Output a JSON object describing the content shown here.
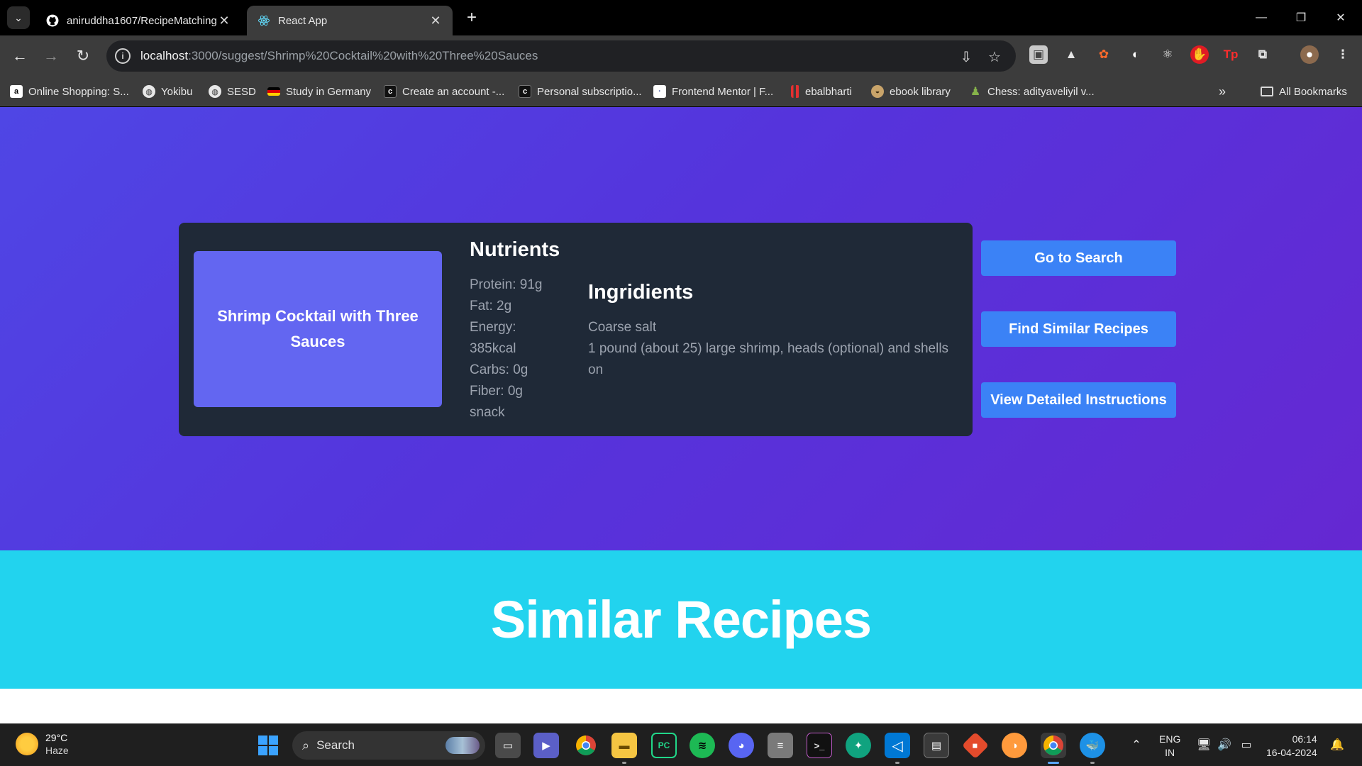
{
  "browser": {
    "tabs": [
      {
        "title": "aniruddha1607/RecipeMatching",
        "icon": "github-icon",
        "active": false
      },
      {
        "title": "React App",
        "icon": "react-icon",
        "active": true
      }
    ],
    "url_host": "localhost",
    "url_path": ":3000/suggest/Shrimp%20Cocktail%20with%20Three%20Sauces",
    "bookmarks": [
      {
        "label": "Online Shopping: S...",
        "icon": "amazon-icon"
      },
      {
        "label": "Yokibu",
        "icon": "globe-icon"
      },
      {
        "label": "SESD",
        "icon": "globe-icon"
      },
      {
        "label": "Study in Germany",
        "icon": "flag-icon"
      },
      {
        "label": "Create an account -...",
        "icon": "codechef-icon"
      },
      {
        "label": "Personal subscriptio...",
        "icon": "codechef-icon"
      },
      {
        "label": "Frontend Mentor | F...",
        "icon": "frontend-mentor-icon"
      },
      {
        "label": "ebalbharti",
        "icon": "book-icon"
      },
      {
        "label": "ebook library",
        "icon": "library-icon"
      },
      {
        "label": "Chess: adityaveliyil v...",
        "icon": "chess-icon"
      }
    ],
    "all_bookmarks_label": "All Bookmarks"
  },
  "recipe": {
    "name": "Shrimp Cocktail with Three Sauces",
    "nutrients_heading": "Nutrients",
    "nutrients": [
      "Protein: 91g",
      "Fat: 2g",
      "Energy: 385kcal",
      "Carbs: 0g",
      "Fiber: 0g",
      "snack"
    ],
    "ingredients_heading": "Ingridients",
    "ingredients": [
      "Coarse salt",
      "1 pound (about 25) large shrimp, heads (optional) and shells on"
    ]
  },
  "actions": {
    "go_to_search": "Go to Search",
    "find_similar": "Find Similar Recipes",
    "view_instructions": "View Detailed Instructions"
  },
  "similar_heading": "Similar Recipes",
  "taskbar": {
    "weather_temp": "29°C",
    "weather_condition": "Haze",
    "search_label": "Search",
    "lang_line1": "ENG",
    "lang_line2": "IN",
    "time": "06:14",
    "date": "16-04-2024"
  },
  "colors": {
    "hero_gradient_start": "#4f46e5",
    "hero_gradient_end": "#6528d2",
    "card_bg": "#1f2937",
    "recipe_box": "#6366f1",
    "button": "#3b82f6",
    "similar_bg": "#22d3ee"
  }
}
